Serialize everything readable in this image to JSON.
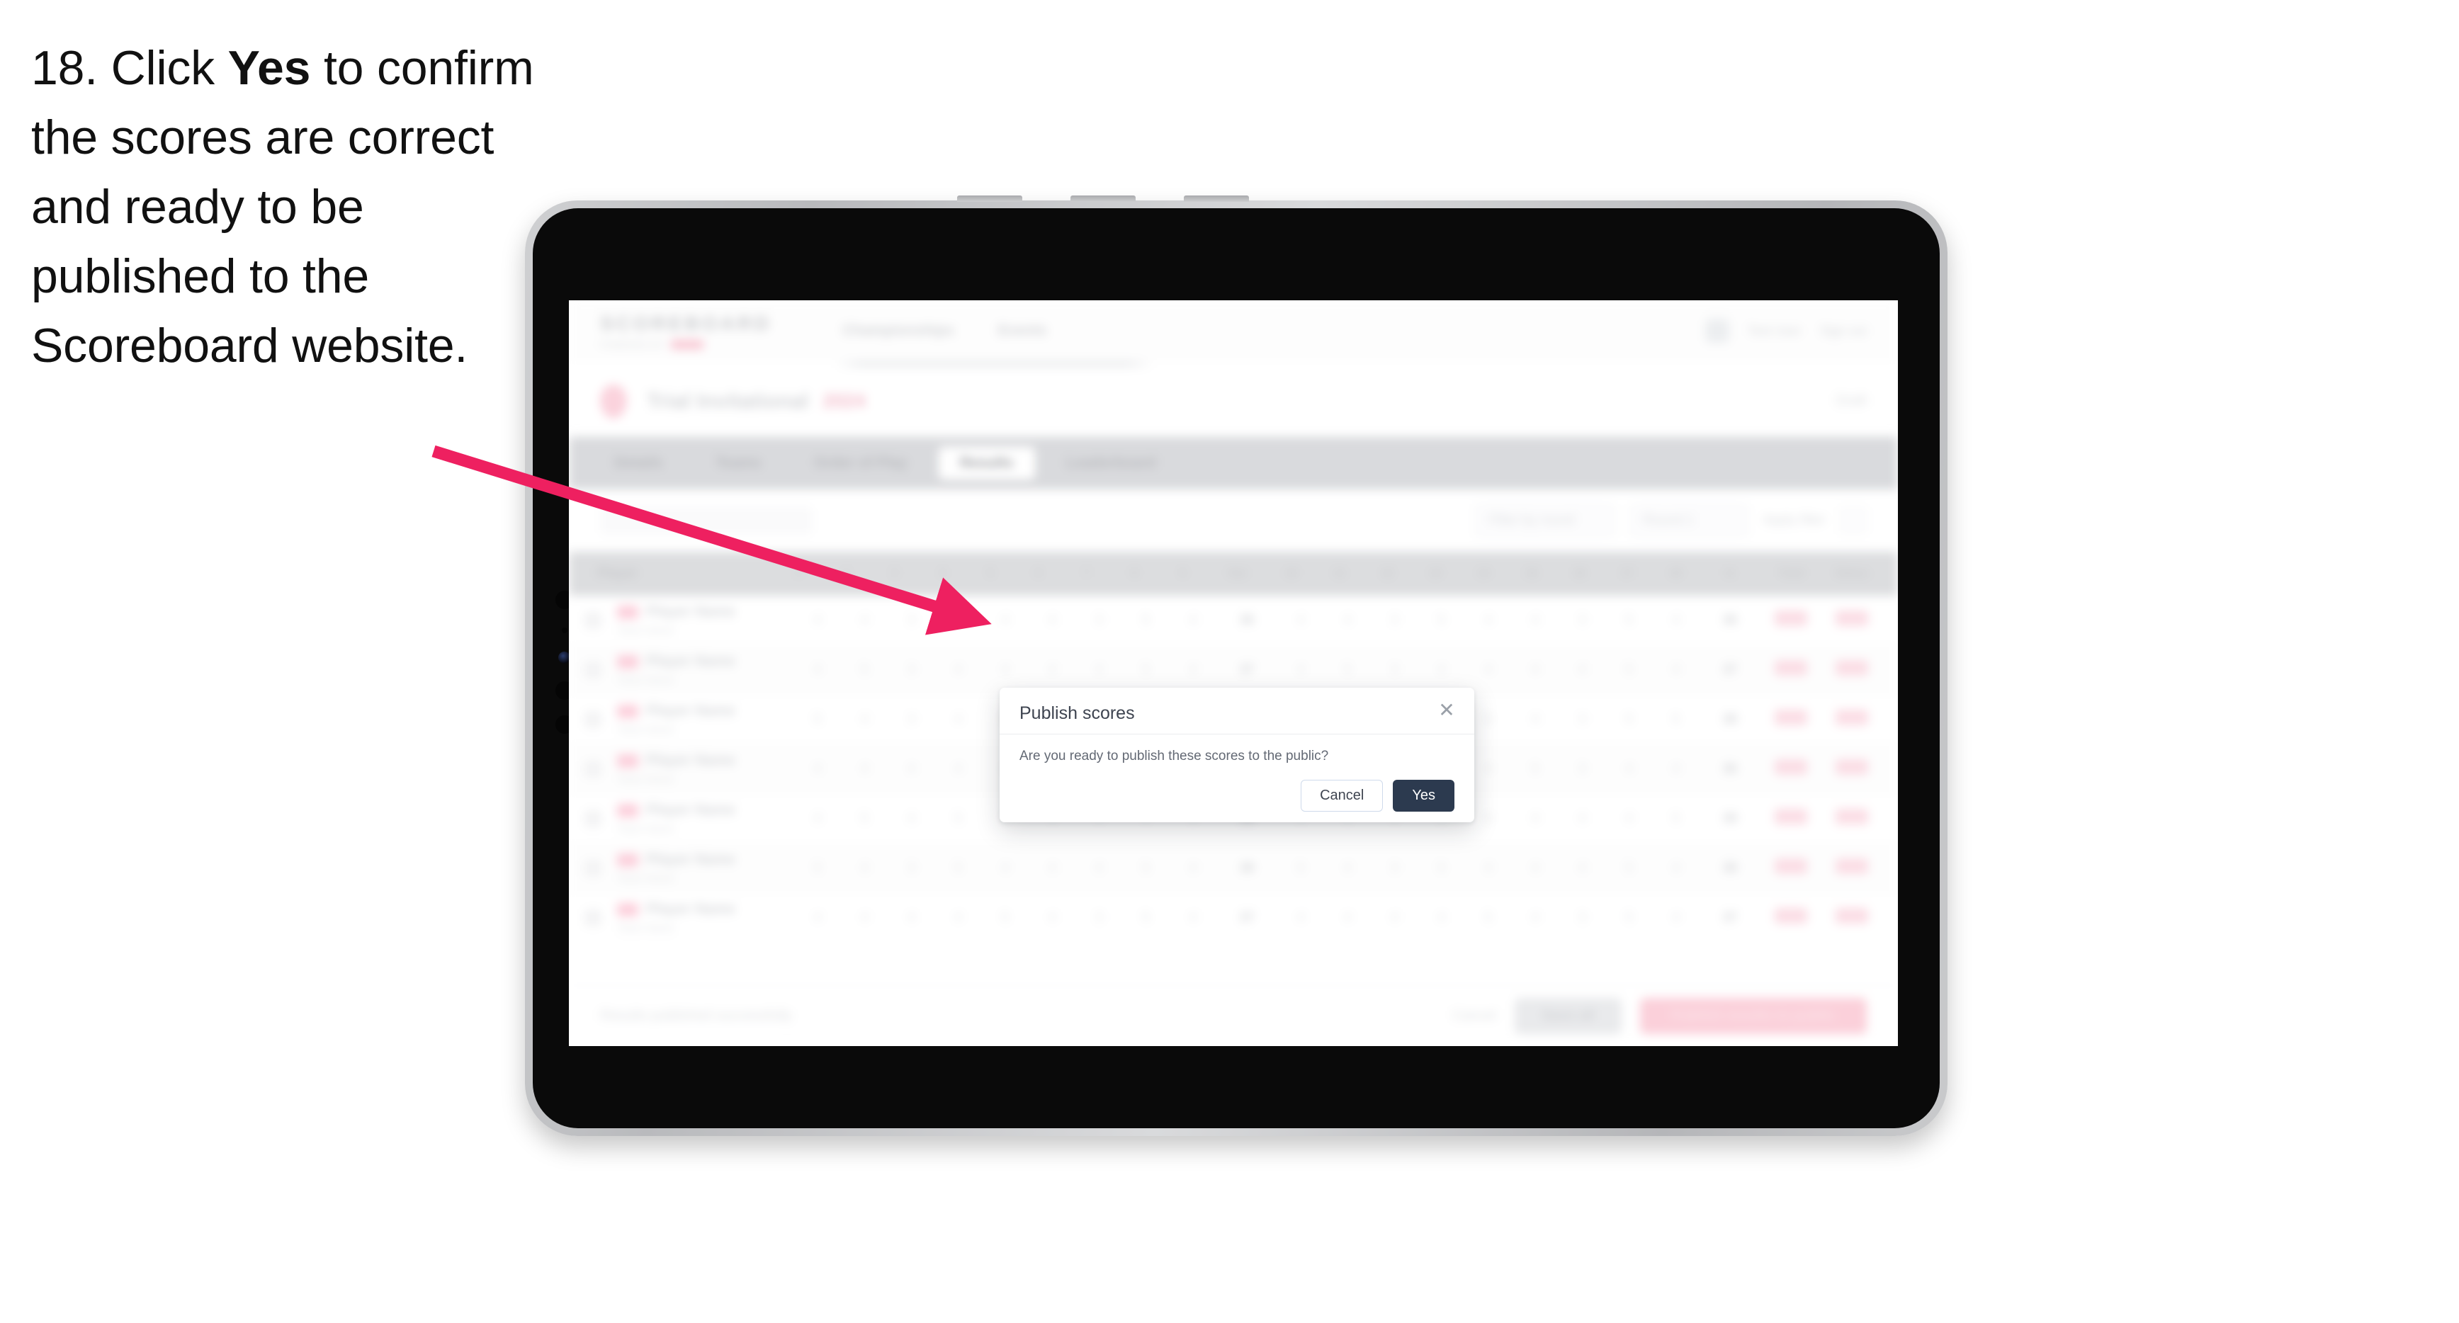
{
  "instruction": {
    "step_number": "18.",
    "text_before_bold": "Click ",
    "bold_word": "Yes",
    "text_after_bold": " to confirm the scores are correct and ready to be published to the Scoreboard website."
  },
  "annotation": {
    "arrow_color": "#ee2060",
    "points_to": "yes-button"
  },
  "device": {
    "type": "tablet",
    "bezel_color": "#c8c9cc",
    "screen_bezel_color": "#0a0a0a"
  },
  "app": {
    "header": {
      "brand_mark": "SCOREBOARD",
      "brand_sub": "POWERED BY",
      "nav_items": [
        "Championships",
        "Events"
      ],
      "user_name": "Test User",
      "sign_out": "Sign out"
    },
    "competition": {
      "title": "Trial Invitational",
      "date": "2024",
      "status": "Draft"
    },
    "tabs": [
      {
        "label": "Details",
        "active": false
      },
      {
        "label": "Teams",
        "active": false
      },
      {
        "label": "Order of Play",
        "active": false
      },
      {
        "label": "Results",
        "active": true
      },
      {
        "label": "Leaderboard",
        "active": false
      }
    ],
    "filters": {
      "search_placeholder": "Search",
      "round_label": "Filter by round",
      "select_label": "Round 1",
      "apply_label": "Apply filter"
    },
    "table": {
      "columns": [
        "Player",
        "1",
        "2",
        "3",
        "4",
        "5",
        "6",
        "7",
        "8",
        "9",
        "Out",
        "10",
        "11",
        "12",
        "13",
        "14",
        "15",
        "16",
        "17",
        "18",
        "In",
        "Total",
        "Status"
      ],
      "rows": [
        {
          "name": "Player Name",
          "sub": "Team Name",
          "scores": [
            "4",
            "4",
            "3",
            "5",
            "4",
            "4",
            "3",
            "5",
            "4"
          ],
          "total": "36",
          "status": "Final"
        },
        {
          "name": "Player Name",
          "sub": "Team Name",
          "scores": [
            "4",
            "5",
            "3",
            "4",
            "4",
            "4",
            "4",
            "5",
            "4"
          ],
          "total": "37",
          "status": "Final"
        },
        {
          "name": "Player Name",
          "sub": "Team Name",
          "scores": [
            "5",
            "4",
            "3",
            "4",
            "5",
            "4",
            "3",
            "5",
            "5"
          ],
          "total": "38",
          "status": "Final"
        },
        {
          "name": "Player Name",
          "sub": "Team Name",
          "scores": [
            "4",
            "4",
            "4",
            "4",
            "4",
            "5",
            "3",
            "4",
            "4"
          ],
          "total": "36",
          "status": "Final"
        },
        {
          "name": "Player Name",
          "sub": "Team Name",
          "scores": [
            "4",
            "5",
            "4",
            "5",
            "4",
            "4",
            "4",
            "4",
            "5"
          ],
          "total": "39",
          "status": "Final"
        },
        {
          "name": "Player Name",
          "sub": "Team Name",
          "scores": [
            "5",
            "4",
            "3",
            "5",
            "4",
            "4",
            "4",
            "5",
            "4"
          ],
          "total": "38",
          "status": "Final"
        },
        {
          "name": "Player Name",
          "sub": "Team Name",
          "scores": [
            "4",
            "4",
            "4",
            "4",
            "5",
            "4",
            "3",
            "5",
            "4"
          ],
          "total": "37",
          "status": "Final"
        }
      ]
    },
    "footer": {
      "note": "Results published successfully",
      "link_label": "Cancel",
      "secondary_label": "Save all",
      "primary_label": "Publish results to public"
    }
  },
  "modal": {
    "title": "Publish scores",
    "message": "Are you ready to publish these scores to the public?",
    "close_icon": "close-icon",
    "cancel_label": "Cancel",
    "confirm_label": "Yes",
    "confirm_bg": "#2c3a4f"
  }
}
